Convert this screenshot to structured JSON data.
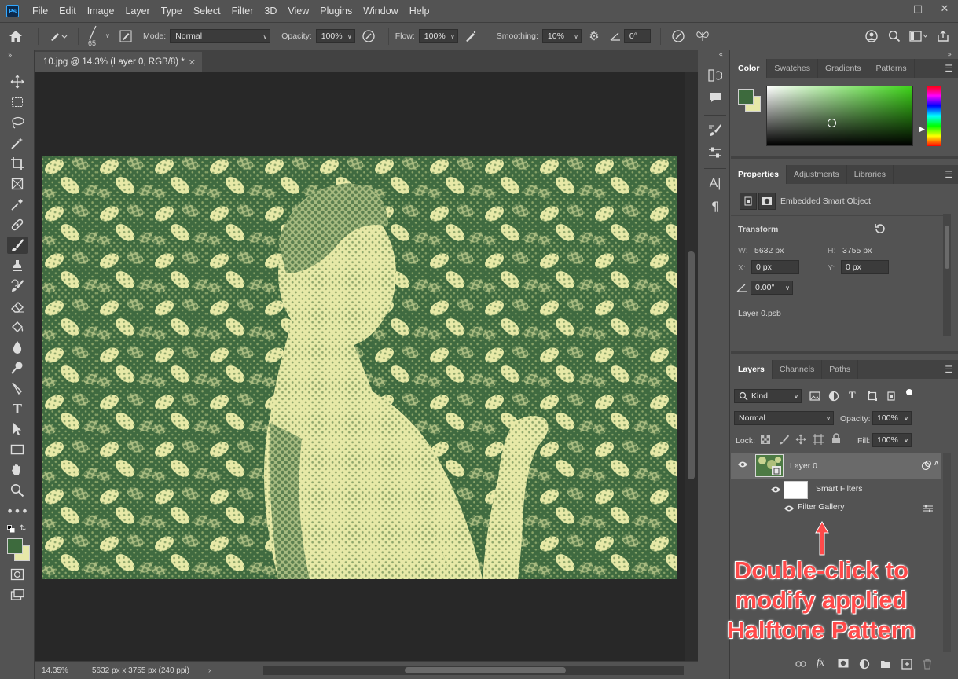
{
  "app": {
    "logo": "Ps",
    "menu": [
      "File",
      "Edit",
      "Image",
      "Layer",
      "Type",
      "Select",
      "Filter",
      "3D",
      "View",
      "Plugins",
      "Window",
      "Help"
    ]
  },
  "options_bar": {
    "brush_size": "65",
    "mode_label": "Mode:",
    "mode_value": "Normal",
    "opacity_label": "Opacity:",
    "opacity_value": "100%",
    "flow_label": "Flow:",
    "flow_value": "100%",
    "smoothing_label": "Smoothing:",
    "smoothing_value": "10%",
    "angle_value": "0°"
  },
  "document": {
    "tab_title": "10.jpg @ 14.3% (Layer 0, RGB/8) *",
    "zoom": "14.35%",
    "dimensions": "5632 px x 3755 px (240 ppi)"
  },
  "color_panel": {
    "tabs": [
      "Color",
      "Swatches",
      "Gradients",
      "Patterns"
    ],
    "foreground": "#3d6a3d",
    "background": "#e6e8a8"
  },
  "properties_panel": {
    "tabs": [
      "Properties",
      "Adjustments",
      "Libraries"
    ],
    "object_type": "Embedded Smart Object",
    "transform_label": "Transform",
    "w_label": "W:",
    "w_value": "5632 px",
    "h_label": "H:",
    "h_value": "3755 px",
    "x_label": "X:",
    "x_value": "0 px",
    "y_label": "Y:",
    "y_value": "0 px",
    "angle_value": "0.00°",
    "linked_file": "Layer 0.psb"
  },
  "layers_panel": {
    "tabs": [
      "Layers",
      "Channels",
      "Paths"
    ],
    "filter_kind": "Kind",
    "blend_mode": "Normal",
    "opacity_label": "Opacity:",
    "opacity_value": "100%",
    "lock_label": "Lock:",
    "fill_label": "Fill:",
    "fill_value": "100%",
    "layers": [
      {
        "name": "Layer 0"
      },
      {
        "name": "Smart Filters"
      },
      {
        "name": "Filter Gallery"
      }
    ]
  },
  "annotation": {
    "lines": [
      "Double-click to",
      "modify applied",
      "Halftone Pattern"
    ],
    "color": "#ff4a4a"
  }
}
